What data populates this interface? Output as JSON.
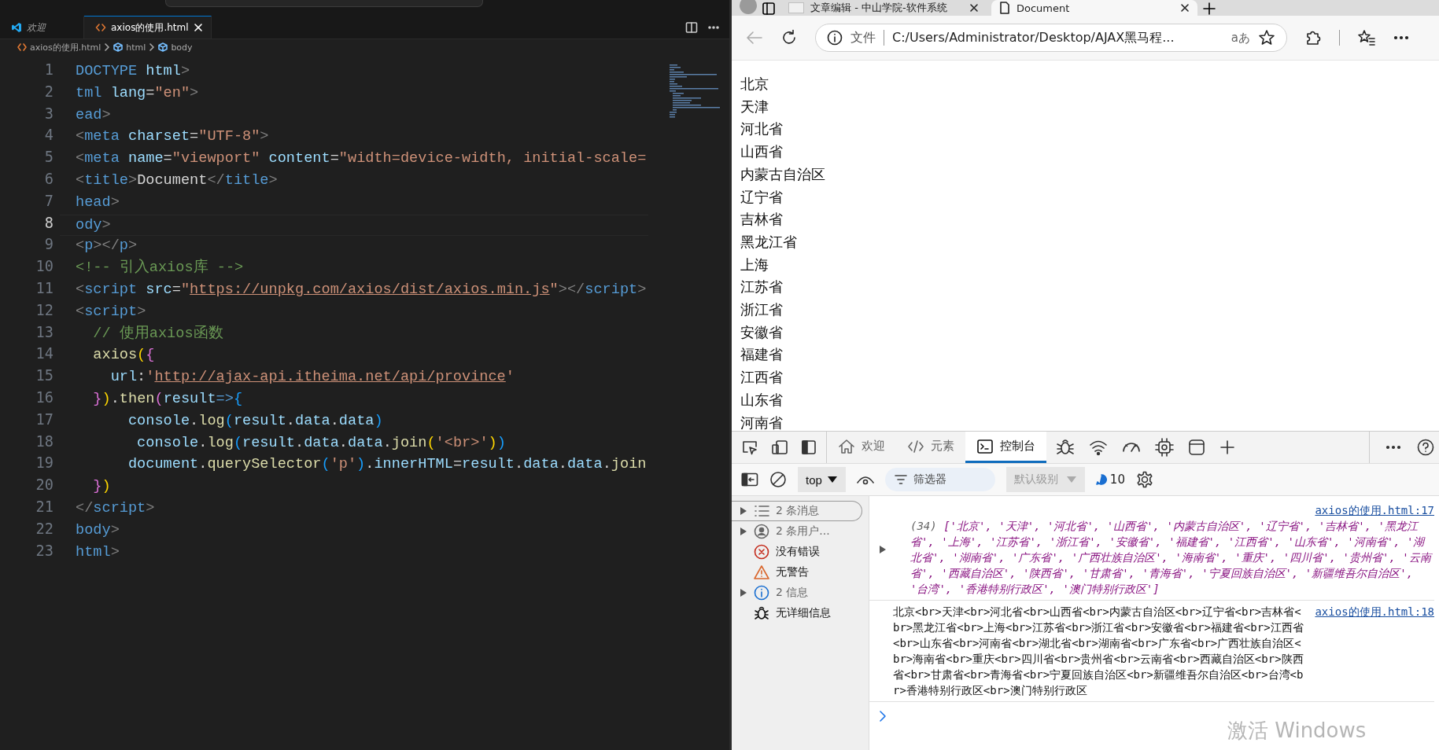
{
  "editor": {
    "tabs": [
      {
        "label": "欢迎",
        "kind": "welcome",
        "selected": false
      },
      {
        "label": "axios的使用.html",
        "kind": "file",
        "selected": true
      }
    ],
    "breadcrumb": [
      "axios的使用.html",
      "html",
      "body"
    ],
    "lines": [
      {
        "number": "1",
        "current": false,
        "tokens": [
          {
            "kind": "tag",
            "text": "DOCTYPE"
          },
          {
            "kind": "attr",
            "text": " html"
          },
          {
            "kind": "punct",
            "text": ">"
          }
        ]
      },
      {
        "number": "2",
        "current": false,
        "tokens": [
          {
            "kind": "tag",
            "text": "tml"
          },
          {
            "kind": "attr",
            "text": " lang"
          },
          {
            "kind": "text",
            "text": "="
          },
          {
            "kind": "string",
            "text": "\"en\""
          },
          {
            "kind": "punct",
            "text": ">"
          }
        ]
      },
      {
        "number": "3",
        "current": false,
        "tokens": [
          {
            "kind": "tag",
            "text": "ead"
          },
          {
            "kind": "punct",
            "text": ">"
          }
        ]
      },
      {
        "number": "4",
        "current": false,
        "tokens": [
          {
            "kind": "punct",
            "text": "<"
          },
          {
            "kind": "tag",
            "text": "meta"
          },
          {
            "kind": "attr",
            "text": " charset"
          },
          {
            "kind": "text",
            "text": "="
          },
          {
            "kind": "string",
            "text": "\"UTF-8\""
          },
          {
            "kind": "punct",
            "text": ">"
          }
        ]
      },
      {
        "number": "5",
        "current": false,
        "tokens": [
          {
            "kind": "punct",
            "text": "<"
          },
          {
            "kind": "tag",
            "text": "meta"
          },
          {
            "kind": "attr",
            "text": " name"
          },
          {
            "kind": "text",
            "text": "="
          },
          {
            "kind": "string",
            "text": "\"viewport\""
          },
          {
            "kind": "attr",
            "text": " content"
          },
          {
            "kind": "text",
            "text": "="
          },
          {
            "kind": "string",
            "text": "\"width=device-width, initial-scale="
          }
        ]
      },
      {
        "number": "6",
        "current": false,
        "tokens": [
          {
            "kind": "punct",
            "text": "<"
          },
          {
            "kind": "tag",
            "text": "title"
          },
          {
            "kind": "punct",
            "text": ">"
          },
          {
            "kind": "text",
            "text": "Document"
          },
          {
            "kind": "punct",
            "text": "</"
          },
          {
            "kind": "tag",
            "text": "title"
          },
          {
            "kind": "punct",
            "text": ">"
          }
        ]
      },
      {
        "number": "7",
        "current": false,
        "tokens": [
          {
            "kind": "tag",
            "text": "head"
          },
          {
            "kind": "punct",
            "text": ">"
          }
        ]
      },
      {
        "number": "8",
        "current": true,
        "tokens": [
          {
            "kind": "tag",
            "text": "ody"
          },
          {
            "kind": "punct",
            "text": ">"
          }
        ]
      },
      {
        "number": "9",
        "current": false,
        "tokens": [
          {
            "kind": "punct",
            "text": "<"
          },
          {
            "kind": "tag",
            "text": "p"
          },
          {
            "kind": "punct",
            "text": "></"
          },
          {
            "kind": "tag",
            "text": "p"
          },
          {
            "kind": "punct",
            "text": ">"
          }
        ]
      },
      {
        "number": "10",
        "current": false,
        "tokens": [
          {
            "kind": "comment",
            "text": "<!-- 引入axios库 -->"
          }
        ]
      },
      {
        "number": "11",
        "current": false,
        "tokens": [
          {
            "kind": "punct",
            "text": "<"
          },
          {
            "kind": "tag",
            "text": "script"
          },
          {
            "kind": "attr",
            "text": " src"
          },
          {
            "kind": "text",
            "text": "="
          },
          {
            "kind": "string",
            "text": "\""
          },
          {
            "kind": "link",
            "text": "https://unpkg.com/axios/dist/axios.min.js"
          },
          {
            "kind": "string",
            "text": "\""
          },
          {
            "kind": "punct",
            "text": "></"
          },
          {
            "kind": "tag",
            "text": "script"
          },
          {
            "kind": "punct",
            "text": ">"
          }
        ]
      },
      {
        "number": "12",
        "current": false,
        "tokens": [
          {
            "kind": "punct",
            "text": "<"
          },
          {
            "kind": "tag",
            "text": "script"
          },
          {
            "kind": "punct",
            "text": ">"
          }
        ]
      },
      {
        "number": "13",
        "current": false,
        "tokens": [
          {
            "kind": "comment",
            "text": "  // 使用axios函数"
          }
        ]
      },
      {
        "number": "14",
        "current": false,
        "tokens": [
          {
            "kind": "func",
            "text": "  axios"
          },
          {
            "kind": "b1",
            "text": "("
          },
          {
            "kind": "b2",
            "text": "{"
          }
        ]
      },
      {
        "number": "15",
        "current": false,
        "tokens": [
          {
            "kind": "var",
            "text": "    url"
          },
          {
            "kind": "text",
            "text": ":"
          },
          {
            "kind": "string",
            "text": "'"
          },
          {
            "kind": "link",
            "text": "http://ajax-api.itheima.net/api/province"
          },
          {
            "kind": "string",
            "text": "'"
          }
        ]
      },
      {
        "number": "16",
        "current": false,
        "tokens": [
          {
            "kind": "b2",
            "text": "  }"
          },
          {
            "kind": "b1",
            "text": ")"
          },
          {
            "kind": "text",
            "text": "."
          },
          {
            "kind": "func",
            "text": "then"
          },
          {
            "kind": "b2",
            "text": "("
          },
          {
            "kind": "var",
            "text": "result"
          },
          {
            "kind": "keyword",
            "text": "=>"
          },
          {
            "kind": "b3",
            "text": "{"
          }
        ]
      },
      {
        "number": "17",
        "current": false,
        "tokens": [
          {
            "kind": "var",
            "text": "      console"
          },
          {
            "kind": "text",
            "text": "."
          },
          {
            "kind": "func",
            "text": "log"
          },
          {
            "kind": "b3",
            "text": "("
          },
          {
            "kind": "var",
            "text": "result"
          },
          {
            "kind": "text",
            "text": "."
          },
          {
            "kind": "var",
            "text": "data"
          },
          {
            "kind": "text",
            "text": "."
          },
          {
            "kind": "var",
            "text": "data"
          },
          {
            "kind": "b3",
            "text": ")"
          }
        ]
      },
      {
        "number": "18",
        "current": false,
        "tokens": [
          {
            "kind": "var",
            "text": "       console"
          },
          {
            "kind": "text",
            "text": "."
          },
          {
            "kind": "func",
            "text": "log"
          },
          {
            "kind": "b3",
            "text": "("
          },
          {
            "kind": "var",
            "text": "result"
          },
          {
            "kind": "text",
            "text": "."
          },
          {
            "kind": "var",
            "text": "data"
          },
          {
            "kind": "text",
            "text": "."
          },
          {
            "kind": "var",
            "text": "data"
          },
          {
            "kind": "text",
            "text": "."
          },
          {
            "kind": "func",
            "text": "join"
          },
          {
            "kind": "b1",
            "text": "("
          },
          {
            "kind": "string",
            "text": "'<br>'"
          },
          {
            "kind": "b1",
            "text": ")"
          },
          {
            "kind": "b3",
            "text": ")"
          }
        ]
      },
      {
        "number": "19",
        "current": false,
        "tokens": [
          {
            "kind": "var",
            "text": "      document"
          },
          {
            "kind": "text",
            "text": "."
          },
          {
            "kind": "func",
            "text": "querySelector"
          },
          {
            "kind": "b3",
            "text": "("
          },
          {
            "kind": "string",
            "text": "'p'"
          },
          {
            "kind": "b3",
            "text": ")"
          },
          {
            "kind": "text",
            "text": "."
          },
          {
            "kind": "var",
            "text": "innerHTML"
          },
          {
            "kind": "text",
            "text": "="
          },
          {
            "kind": "var",
            "text": "result"
          },
          {
            "kind": "text",
            "text": "."
          },
          {
            "kind": "var",
            "text": "data"
          },
          {
            "kind": "text",
            "text": "."
          },
          {
            "kind": "var",
            "text": "data"
          },
          {
            "kind": "text",
            "text": "."
          },
          {
            "kind": "func",
            "text": "join"
          }
        ]
      },
      {
        "number": "20",
        "current": false,
        "tokens": [
          {
            "kind": "b2",
            "text": "  }"
          },
          {
            "kind": "b1",
            "text": ")"
          }
        ]
      },
      {
        "number": "21",
        "current": false,
        "tokens": [
          {
            "kind": "punct",
            "text": "</"
          },
          {
            "kind": "tag",
            "text": "script"
          },
          {
            "kind": "punct",
            "text": ">"
          }
        ]
      },
      {
        "number": "22",
        "current": false,
        "tokens": [
          {
            "kind": "tag",
            "text": "body"
          },
          {
            "kind": "punct",
            "text": ">"
          }
        ]
      },
      {
        "number": "23",
        "current": false,
        "tokens": [
          {
            "kind": "tag",
            "text": "html"
          },
          {
            "kind": "punct",
            "text": ">"
          }
        ]
      }
    ]
  },
  "browser": {
    "tabs": [
      {
        "title": "文章编辑 - 中山学院-软件系统",
        "selected": false
      },
      {
        "title": "Document",
        "selected": true
      }
    ],
    "address": {
      "scheme_label": "文件",
      "url": "C:/Users/Administrator/Desktop/AJAX黑马程...",
      "reader": "aあ"
    },
    "page_lines": [
      "北京",
      "天津",
      "河北省",
      "山西省",
      "内蒙古自治区",
      "辽宁省",
      "吉林省",
      "黑龙江省",
      "上海",
      "江苏省",
      "浙江省",
      "安徽省",
      "福建省",
      "江西省",
      "山东省",
      "河南省"
    ]
  },
  "devtools": {
    "tabs": [
      {
        "label": "欢迎",
        "kind": "home",
        "selected": false
      },
      {
        "label": "元素",
        "kind": "code",
        "selected": false
      },
      {
        "label": "控制台",
        "kind": "console",
        "selected": true
      }
    ],
    "context": "top",
    "filter_placeholder": "筛选器",
    "levels": "默认级别",
    "issues": "10",
    "sidebar": [
      {
        "label": "2 条消息",
        "kind": "messages",
        "expandable": true,
        "selected": true
      },
      {
        "label": "2 条用户...",
        "kind": "user",
        "expandable": true,
        "selected": false
      },
      {
        "label": "没有错误",
        "kind": "errors",
        "expandable": false,
        "selected": false
      },
      {
        "label": "无警告",
        "kind": "warnings",
        "expandable": false,
        "selected": false
      },
      {
        "label": "2 信息",
        "kind": "info",
        "expandable": true,
        "selected": false
      },
      {
        "label": "无详细信息",
        "kind": "verbose",
        "expandable": false,
        "selected": false
      }
    ],
    "messages": [
      {
        "kind": "array",
        "source": "axios的使用.html:17",
        "count": "(34)",
        "text": "['北京', '天津', '河北省', '山西省', '内蒙古自治区', '辽宁省', '吉林省', '黑龙江省', '上海', '江苏省', '浙江省', '安徽省', '福建省', '江西省', '山东省', '河南省', '湖北省', '湖南省', '广东省', '广西壮族自治区', '海南省', '重庆', '四川省', '贵州省', '云南省', '西藏自治区', '陕西省', '甘肃省', '青海省', '宁夏回族自治区', '新疆维吾尔自治区', '台湾', '香港特别行政区', '澳门特别行政区']"
      },
      {
        "kind": "string",
        "source": "axios的使用.html:18",
        "text": "北京<br>天津<br>河北省<br>山西省<br>内蒙古自治区<br>辽宁省<br>吉林省<br>黑龙江省<br>上海<br>江苏省<br>浙江省<br>安徽省<br>福建省<br>江西省<br>山东省<br>河南省<br>湖北省<br>湖南省<br>广东省<br>广西壮族自治区<br>海南省<br>重庆<br>四川省<br>贵州省<br>云南省<br>西藏自治区<br>陕西省<br>甘肃省<br>青海省<br>宁夏回族自治区<br>新疆维吾尔自治区<br>台湾<br>香港特别行政区<br>澳门特别行政区"
      }
    ]
  },
  "os_watermark": "激活 Windows"
}
